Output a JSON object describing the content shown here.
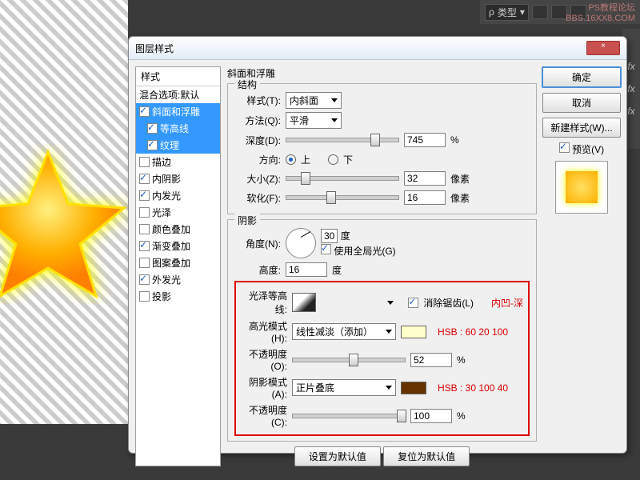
{
  "watermark": {
    "line1": "PS教程论坛",
    "line2": "BBS.16XX8.COM"
  },
  "topbar": {
    "kind_label": "类型",
    "triangle": "▾"
  },
  "dialog": {
    "title": "图层样式",
    "styles_header": "样式",
    "styles": [
      {
        "label": "混合选项:默认",
        "checked": null,
        "blue": false,
        "indent": 0
      },
      {
        "label": "斜面和浮雕",
        "checked": true,
        "blue": true,
        "indent": 0
      },
      {
        "label": "等高线",
        "checked": true,
        "blue": true,
        "indent": 1
      },
      {
        "label": "纹理",
        "checked": true,
        "blue": true,
        "indent": 1
      },
      {
        "label": "描边",
        "checked": false,
        "blue": false,
        "indent": 0
      },
      {
        "label": "内阴影",
        "checked": true,
        "blue": false,
        "indent": 0
      },
      {
        "label": "内发光",
        "checked": true,
        "blue": false,
        "indent": 0
      },
      {
        "label": "光泽",
        "checked": false,
        "blue": false,
        "indent": 0
      },
      {
        "label": "颜色叠加",
        "checked": false,
        "blue": false,
        "indent": 0
      },
      {
        "label": "渐变叠加",
        "checked": true,
        "blue": false,
        "indent": 0
      },
      {
        "label": "图案叠加",
        "checked": false,
        "blue": false,
        "indent": 0
      },
      {
        "label": "外发光",
        "checked": true,
        "blue": false,
        "indent": 0
      },
      {
        "label": "投影",
        "checked": false,
        "blue": false,
        "indent": 0
      }
    ],
    "panel_title": "斜面和浮雕",
    "struct": {
      "legend": "结构",
      "style_lbl": "样式(T):",
      "style_val": "内斜面",
      "tech_lbl": "方法(Q):",
      "tech_val": "平滑",
      "depth_lbl": "深度(D):",
      "depth_val": "745",
      "pct": "%",
      "dir_lbl": "方向:",
      "up": "上",
      "down": "下",
      "size_lbl": "大小(Z):",
      "size_val": "32",
      "px": "像素",
      "soft_lbl": "软化(F):",
      "soft_val": "16"
    },
    "shade": {
      "legend": "阴影",
      "angle_lbl": "角度(N):",
      "angle_val": "30",
      "deg": "度",
      "global": "使用全局光(G)",
      "alt_lbl": "高度:",
      "alt_val": "16",
      "gloss_lbl": "光泽等高线:",
      "aa": "消除锯齿(L)",
      "hmode_lbl": "高光模式(H):",
      "hmode_val": "线性减淡（添加）",
      "hop_lbl": "不透明度(O):",
      "hop_val": "52",
      "smode_lbl": "阴影模式(A):",
      "smode_val": "正片叠底",
      "sop_lbl": "不透明度(C):",
      "sop_val": "100"
    },
    "anno": {
      "a1": "内凹-深",
      "a2": "HSB : 60 20 100",
      "a3": "HSB : 30 100 40"
    },
    "bottom": {
      "b1": "设置为默认值",
      "b2": "复位为默认值"
    },
    "right": {
      "ok": "确定",
      "cancel": "取消",
      "newstyle": "新建样式(W)...",
      "preview": "预览(V)"
    },
    "close": "×"
  },
  "colors": {
    "hilite": "#ffffcc",
    "shadow": "#663300"
  }
}
